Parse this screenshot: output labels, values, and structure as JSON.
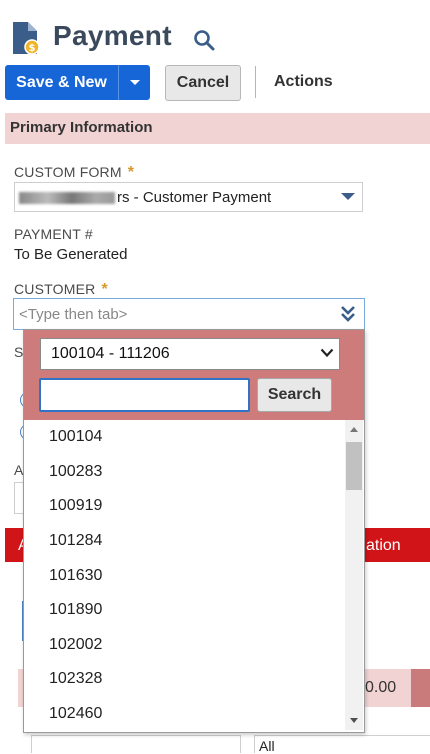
{
  "header": {
    "title": "Payment",
    "icon": "payment-document-icon",
    "search_icon": "search-icon"
  },
  "toolbar": {
    "save_new_label": "Save & New",
    "cancel_label": "Cancel",
    "actions_label": "Actions"
  },
  "section": {
    "title": "Primary Information"
  },
  "fields": {
    "custom_form": {
      "label": "CUSTOM FORM",
      "required_mark": "*",
      "value_visible": "rs - Customer Payment"
    },
    "payment_number": {
      "label": "PAYMENT #",
      "value": "To Be Generated"
    },
    "customer": {
      "label": "CUSTOMER",
      "required_mark": "*",
      "placeholder": "<Type then tab>"
    }
  },
  "background": {
    "partial_s": "S",
    "partial_a": "A",
    "band_right_text": "ation",
    "band_left_text": "A",
    "amount_partial": "0.00",
    "filter_all": "All"
  },
  "popup": {
    "range_selected": "100104 - 111206",
    "search_placeholder": "",
    "search_button": "Search",
    "items": [
      "100104",
      "100283",
      "100919",
      "101284",
      "101630",
      "101890",
      "102002",
      "102328",
      "102460"
    ]
  },
  "colors": {
    "primary_blue": "#1666d8",
    "section_pink": "#f2d3d3",
    "popup_header": "#cd7b7b",
    "red_band": "#d01418",
    "required_star": "#d69a2c"
  }
}
